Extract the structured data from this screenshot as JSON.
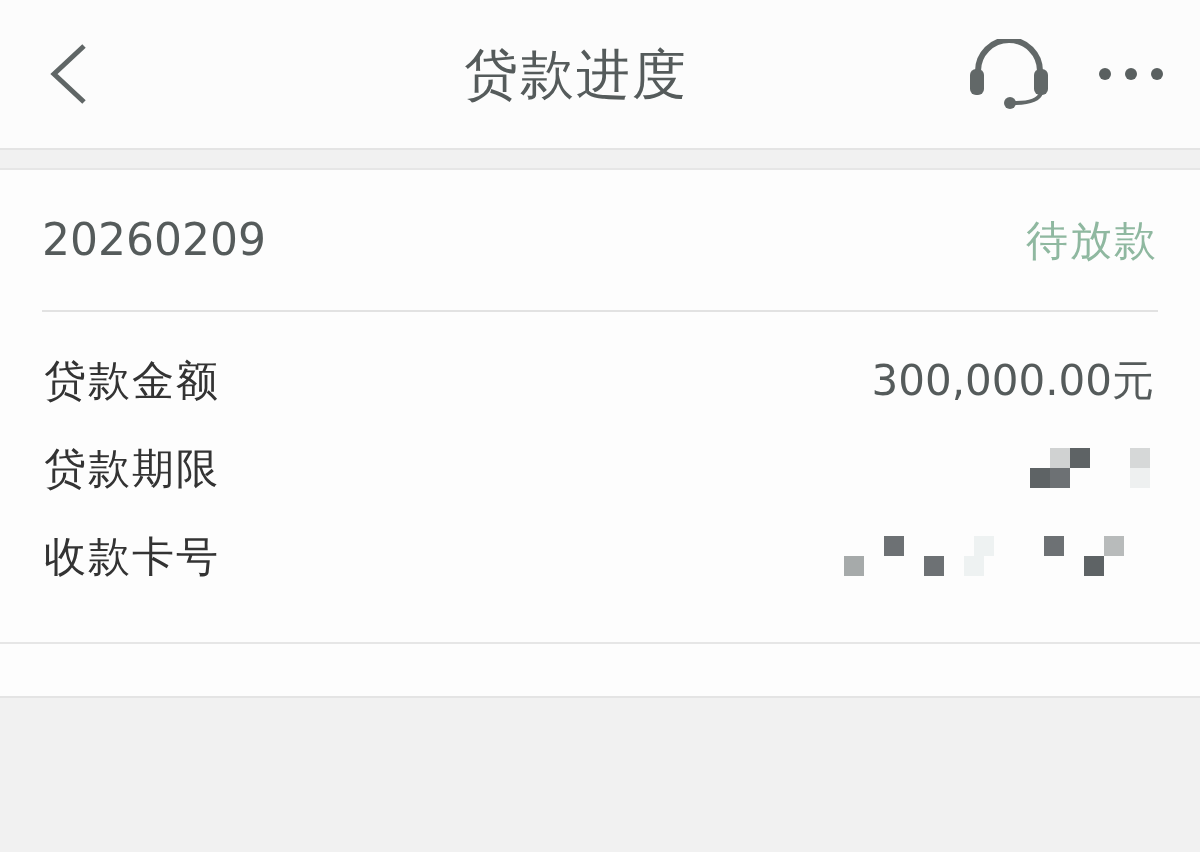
{
  "header": {
    "title": "贷款进度"
  },
  "loan": {
    "number": "20260209",
    "status": "待放款"
  },
  "details": [
    {
      "label": "贷款金额",
      "value": "300,000.00元",
      "kind": "text"
    },
    {
      "label": "贷款期限",
      "kind": "masked"
    },
    {
      "label": "收款卡号",
      "kind": "masked"
    }
  ]
}
